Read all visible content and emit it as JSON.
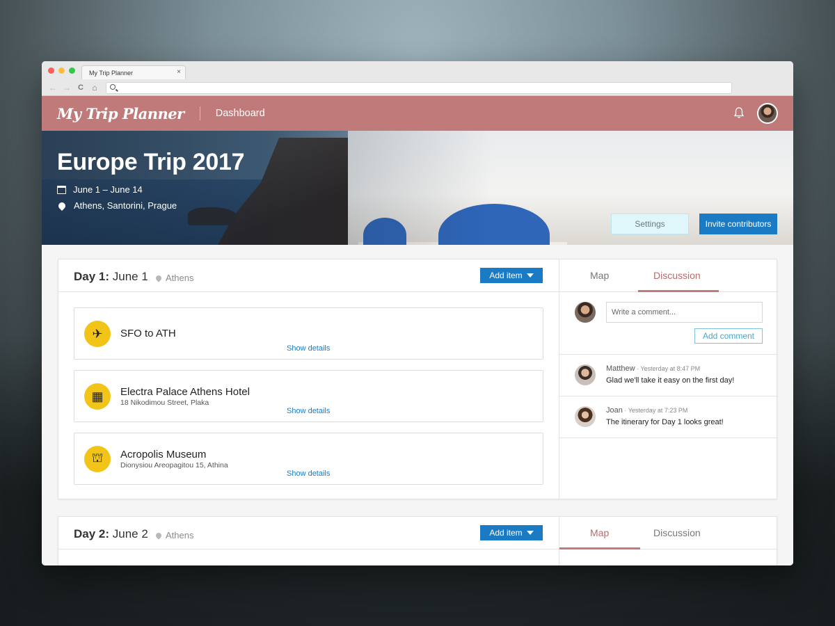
{
  "browser": {
    "tab_title": "My Trip Planner",
    "tab_close": "×",
    "nav": {
      "back": "←",
      "forward": "→",
      "reload": "C",
      "home": "⌂"
    }
  },
  "header": {
    "logo": "My Trip Planner",
    "nav_item": "Dashboard",
    "accent_color": "#c17a7a"
  },
  "trip": {
    "title": "Europe Trip 2017",
    "dates": "June 1 – June 14",
    "places": "Athens, Santorini, Prague",
    "settings_label": "Settings",
    "invite_label": "Invite contributors"
  },
  "days": [
    {
      "label": "Day 1:",
      "date": "June 1",
      "location": "Athens",
      "add_item_label": "Add item",
      "items": [
        {
          "icon": "plane-icon",
          "glyph": "✈",
          "name": "SFO to ATH",
          "address": "",
          "details_label": "Show details"
        },
        {
          "icon": "hotel-icon",
          "glyph": "▦",
          "name": "Electra Palace Athens Hotel",
          "address": "18 Nikodimou Street, Plaka",
          "details_label": "Show details"
        },
        {
          "icon": "museum-icon",
          "glyph": "⛫",
          "name": "Acropolis Museum",
          "address": "Dionysiou Areopagitou 15, Athina",
          "details_label": "Show details"
        }
      ],
      "tabs": {
        "map": "Map",
        "discussion": "Discussion",
        "active": "discussion"
      },
      "comment_placeholder": "Write a comment...",
      "add_comment_label": "Add comment",
      "comments": [
        {
          "author": "Matthew",
          "time": " · Yesterday at 8:47 PM",
          "text": "Glad we'll take it easy on the first day!"
        },
        {
          "author": "Joan",
          "time": " · Yesterday at 7:23 PM",
          "text": "The itinerary for Day 1 looks great!"
        }
      ]
    },
    {
      "label": "Day 2:",
      "date": "June 2",
      "location": "Athens",
      "add_item_label": "Add item",
      "tabs": {
        "map": "Map",
        "discussion": "Discussion",
        "active": "map"
      }
    }
  ]
}
